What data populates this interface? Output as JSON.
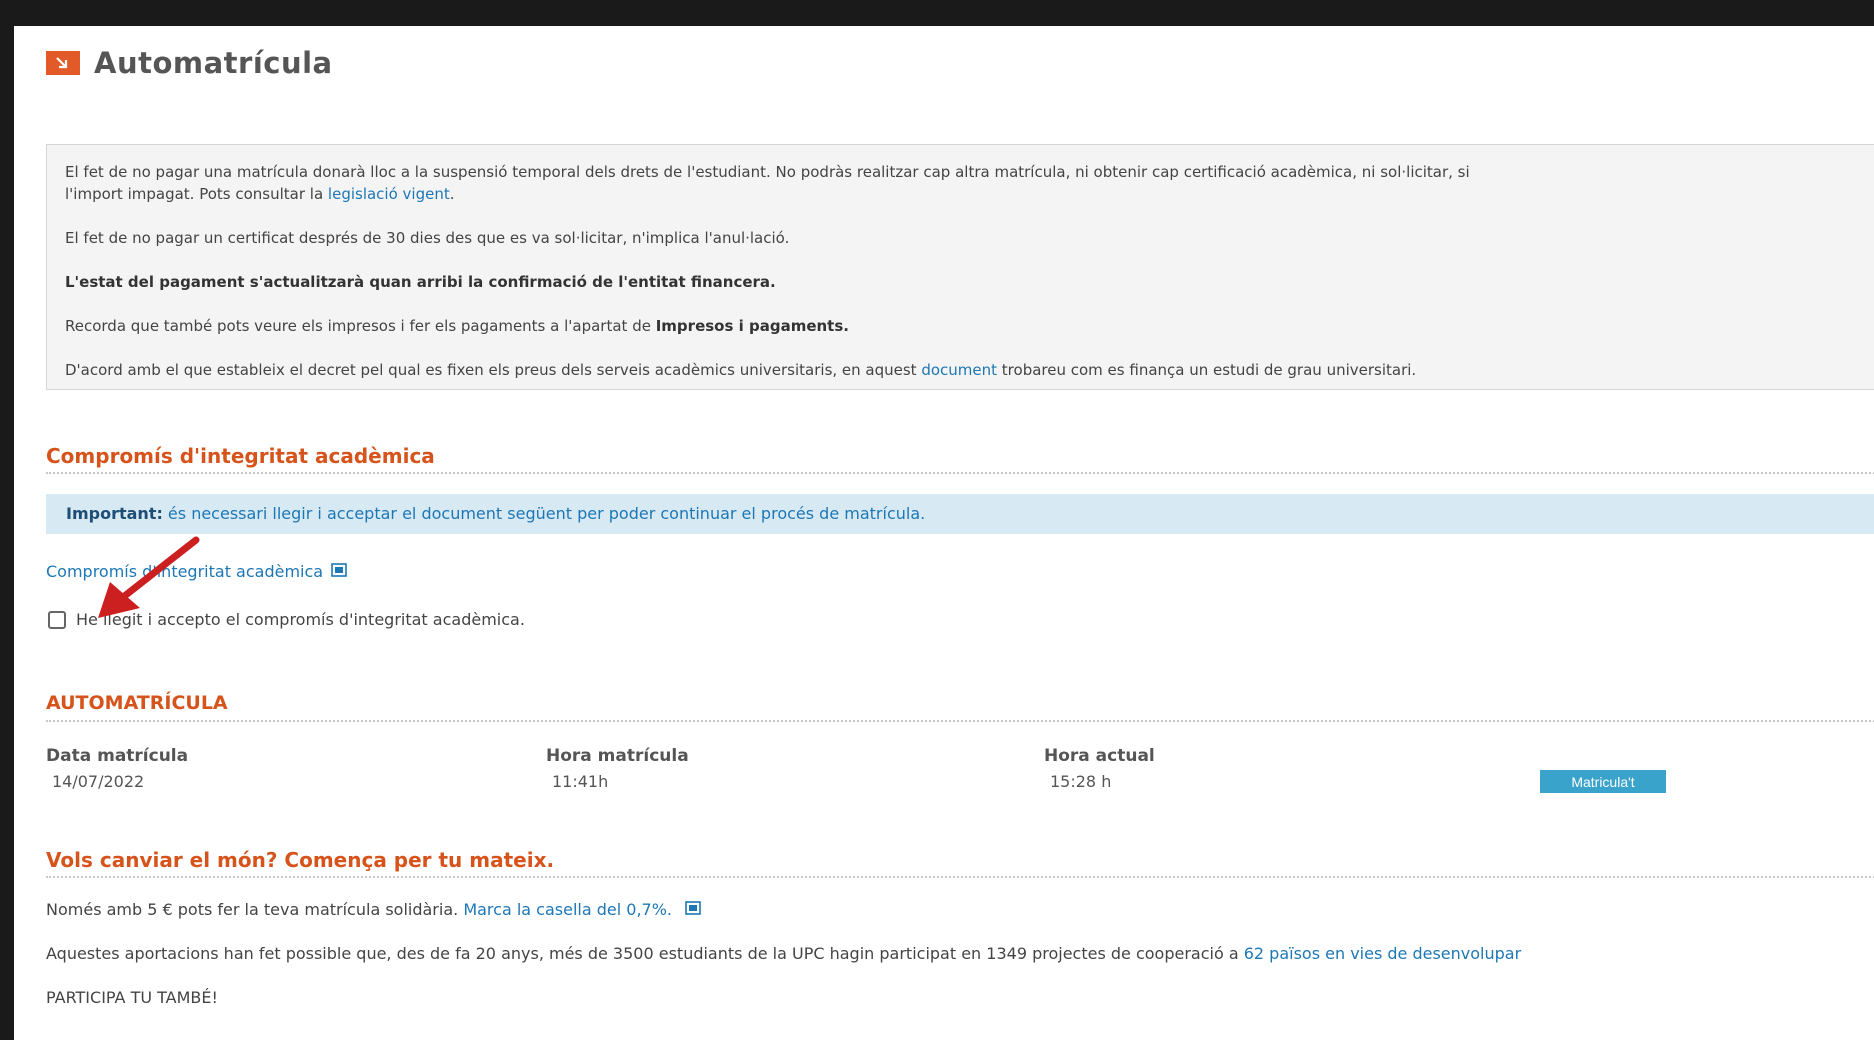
{
  "page": {
    "title": "Automatrícula",
    "title_icon": "arrow-down-right-icon"
  },
  "info": {
    "p1_before_link": "El fet de no pagar una matrícula donarà lloc a la suspensió temporal dels drets de l'estudiant. No podràs realitzar cap altra matrícula, ni obtenir cap certificació acadèmica, ni sol·licitar, si",
    "p1_line2": "l'import impagat. Pots consultar la ",
    "p1_link": "legislació vigent",
    "p1_after_link": ".",
    "p2": "El fet de no pagar un certificat després de 30 dies des que es va sol·licitar, n'implica l'anul·lació.",
    "p3": "L'estat del pagament s'actualitzarà quan arribi la confirmació de l'entitat financera.",
    "p4_before": "Recorda que també pots veure els impresos i fer els pagaments a l'apartat de ",
    "p4_bold": "Impresos i pagaments.",
    "p5_before": "D'acord amb el que estableix el decret pel qual es fixen els preus dels serveis acadèmics universitaris, en aquest ",
    "p5_link": "document",
    "p5_after": " trobareu com es finança un estudi de grau universitari."
  },
  "integrity": {
    "heading": "Compromís d'integritat acadèmica",
    "important_label": "Important:",
    "important_text": " és necessari llegir i acceptar el document següent per poder continuar el procés de matrícula.",
    "doc_link": "Compromís d'integritat acadèmica",
    "checkbox_label": "He llegit i accepto el compromís d'integritat acadèmica.",
    "checkbox_checked": false
  },
  "automatricula": {
    "heading": "AUTOMATRÍCULA",
    "col1_label": "Data matrícula",
    "col1_value": "14/07/2022",
    "col2_label": "Hora matrícula",
    "col2_value": "11:41h",
    "col3_label": "Hora actual",
    "col3_value": "15:28 h",
    "button_label": "Matricula't"
  },
  "solidarity": {
    "heading": "Vols canviar el món? Comença per tu mateix.",
    "line1_before": "Només amb 5 € pots fer la teva matrícula solidària. ",
    "line1_link": "Marca la casella del 0,7%.",
    "line2_before": "Aquestes aportacions han fet possible que, des de fa 20 anys, més de 3500 estudiants de la UPC hagin participat en 1349 projectes de cooperació a ",
    "line2_link": "62 països en vies de desenvolupar",
    "line3": "PARTICIPA TU TAMBÉ!"
  },
  "colors": {
    "accent_orange": "#d6541b",
    "link_blue": "#1d77b5",
    "button_blue": "#3aa3cb",
    "important_bg": "#d7e9f3",
    "annotation_arrow": "#cc1f1f"
  }
}
